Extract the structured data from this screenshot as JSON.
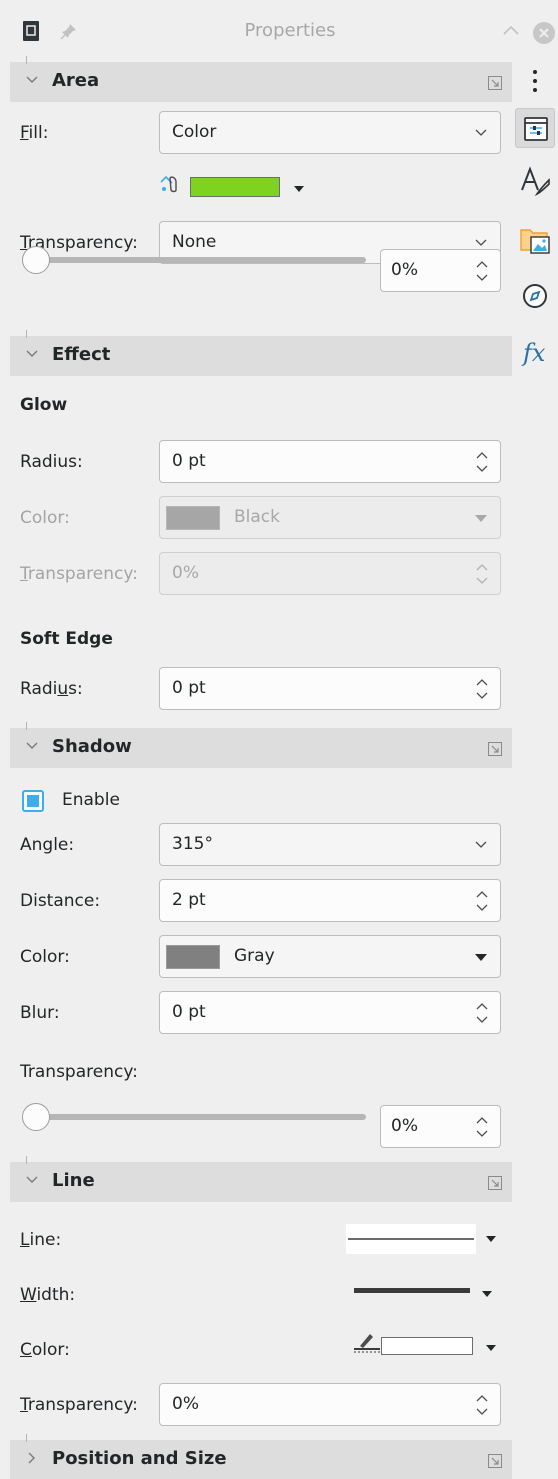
{
  "window": {
    "title": "Properties"
  },
  "area": {
    "header": "Area",
    "fill_label": "Fill:",
    "fill_value": "Color",
    "fill_color": "#7ed321",
    "transparency_label": "Transparency:",
    "transparency_value": "None",
    "slider_percent": 0,
    "slider_value": "0%"
  },
  "effect": {
    "header": "Effect",
    "glow_title": "Glow",
    "glow_radius_label": "Radius:",
    "glow_radius_value": "0 pt",
    "glow_color_label": "Color:",
    "glow_color_value": "Black",
    "glow_transparency_label": "Transparency:",
    "glow_transparency_value": "0%",
    "soft_edge_title": "Soft Edge",
    "soft_radius_label": "Radius:",
    "soft_radius_value": "0 pt"
  },
  "shadow": {
    "header": "Shadow",
    "enable_label": "Enable",
    "enabled": true,
    "angle_label": "Angle:",
    "angle_value": "315°",
    "distance_label": "Distance:",
    "distance_value": "2 pt",
    "color_label": "Color:",
    "color_value": "Gray",
    "color_swatch": "#808080",
    "blur_label": "Blur:",
    "blur_value": "0 pt",
    "transparency_label": "Transparency:",
    "slider_percent": 0,
    "slider_value": "0%"
  },
  "line": {
    "header": "Line",
    "line_label": "Line:",
    "width_label": "Width:",
    "color_label": "Color:",
    "transparency_label": "Transparency:",
    "transparency_value": "0%"
  },
  "position_size": {
    "header": "Position and Size"
  },
  "sidebar_tabs": [
    "properties-tab",
    "styles-tab",
    "gallery-tab",
    "navigator-tab",
    "functions-tab"
  ],
  "colors": {
    "accent": "#3daee9",
    "header_bg": "#dddddd",
    "panel_bg": "#efefef"
  }
}
